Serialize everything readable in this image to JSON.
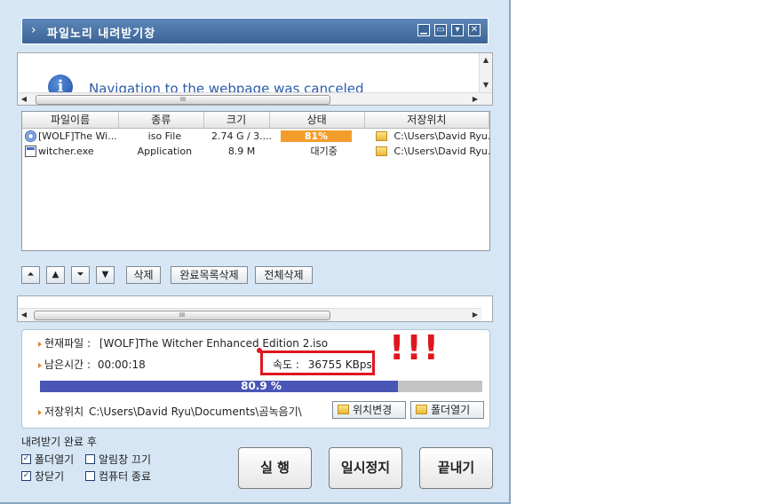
{
  "window": {
    "title": "파일노리 내려받기창",
    "title_chevron": "›",
    "buttons": [
      {
        "name": "help",
        "glyph": "▁"
      },
      {
        "name": "restore",
        "glyph": "▭"
      },
      {
        "name": "menu",
        "glyph": "▾"
      },
      {
        "name": "close",
        "glyph": "✕"
      }
    ]
  },
  "browser": {
    "info_glyph": "i",
    "message": "Navigation to the webpage was canceled",
    "scroll_thumb": "III"
  },
  "list": {
    "columns": [
      "파일이름",
      "종류",
      "크기",
      "상태",
      "저장위치"
    ],
    "rows": [
      {
        "icon": "disc-icon",
        "name": "[WOLF]The Wi...",
        "type": "iso File",
        "size": "2.74 G  / 3....",
        "status": "81%",
        "progress": 81,
        "path": "C:\\Users\\David Ryu..."
      },
      {
        "icon": "exe-icon",
        "name": "witcher.exe",
        "type": "Application",
        "size": "8.9 M",
        "status": "대기중",
        "progress": null,
        "path": "C:\\Users\\David Ryu..."
      }
    ]
  },
  "toolbar": {
    "move_top": "⏶",
    "move_up": "▲",
    "move_bottom": "⏷",
    "move_down": "▼",
    "delete": "삭제",
    "delete_done": "완료목록삭제",
    "delete_all": "전체삭제"
  },
  "pane2": {
    "scroll_thumb": "III"
  },
  "info": {
    "current_file_label": "현재파일 :",
    "current_file": "[WOLF]The Witcher Enhanced Edition 2.iso",
    "remaining_label": "남은시간 :",
    "remaining": "00:00:18",
    "speed_label": "속도 :",
    "speed": "36755 KBps",
    "progress_label": "80.9 %",
    "progress": 80.9,
    "save_path_label": "저장위치",
    "save_path": "C:\\Users\\David Ryu\\Documents\\곰녹음기\\",
    "change_location": "위치변경",
    "open_folder": "폴더열기"
  },
  "after_download": {
    "label": "내려받기 완료 후",
    "options": [
      {
        "label": "폴더열기",
        "checked": true
      },
      {
        "label": "알림창 끄기",
        "checked": false
      },
      {
        "label": "창닫기",
        "checked": true
      },
      {
        "label": "컴퓨터 종료",
        "checked": false
      }
    ]
  },
  "actions": {
    "run": "실 행",
    "pause": "일시정지",
    "exit": "끝내기"
  },
  "annotation": {
    "exclaim": "!!!",
    "color": "#e0161e"
  }
}
